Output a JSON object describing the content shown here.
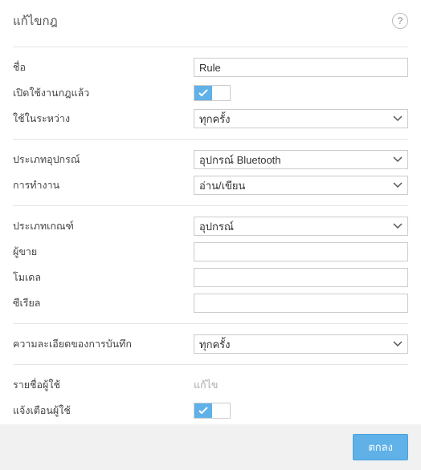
{
  "dialog": {
    "title": "แก้ไขกฎ",
    "help_tooltip": "?"
  },
  "fields": {
    "name": {
      "label": "ชื่อ",
      "value": "Rule"
    },
    "rule_enabled": {
      "label": "เปิดใช้งานกฎแล้ว",
      "state": "on"
    },
    "apply_during": {
      "label": "ใช้ในระหว่าง",
      "value": "ทุกครั้ง"
    },
    "device_type": {
      "label": "ประเภทอุปกรณ์",
      "value": "อุปกรณ์ Bluetooth"
    },
    "operation": {
      "label": "การทำงาน",
      "value": "อ่าน/เขียน"
    },
    "criteria_type": {
      "label": "ประเภทเกณฑ์",
      "value": "อุปกรณ์"
    },
    "vendor": {
      "label": "ผู้ขาย",
      "value": ""
    },
    "model": {
      "label": "โมเดล",
      "value": ""
    },
    "serial": {
      "label": "ซีเรียล",
      "value": ""
    },
    "log_detail": {
      "label": "ความละเอียดของการบันทึก",
      "value": "ทุกครั้ง"
    },
    "user_list": {
      "label": "รายชื่อผู้ใช้",
      "value": "แก้ไข"
    },
    "notify_user": {
      "label": "แจ้งเตือนผู้ใช้",
      "state": "on"
    }
  },
  "footer": {
    "ok": "ตกลง"
  }
}
